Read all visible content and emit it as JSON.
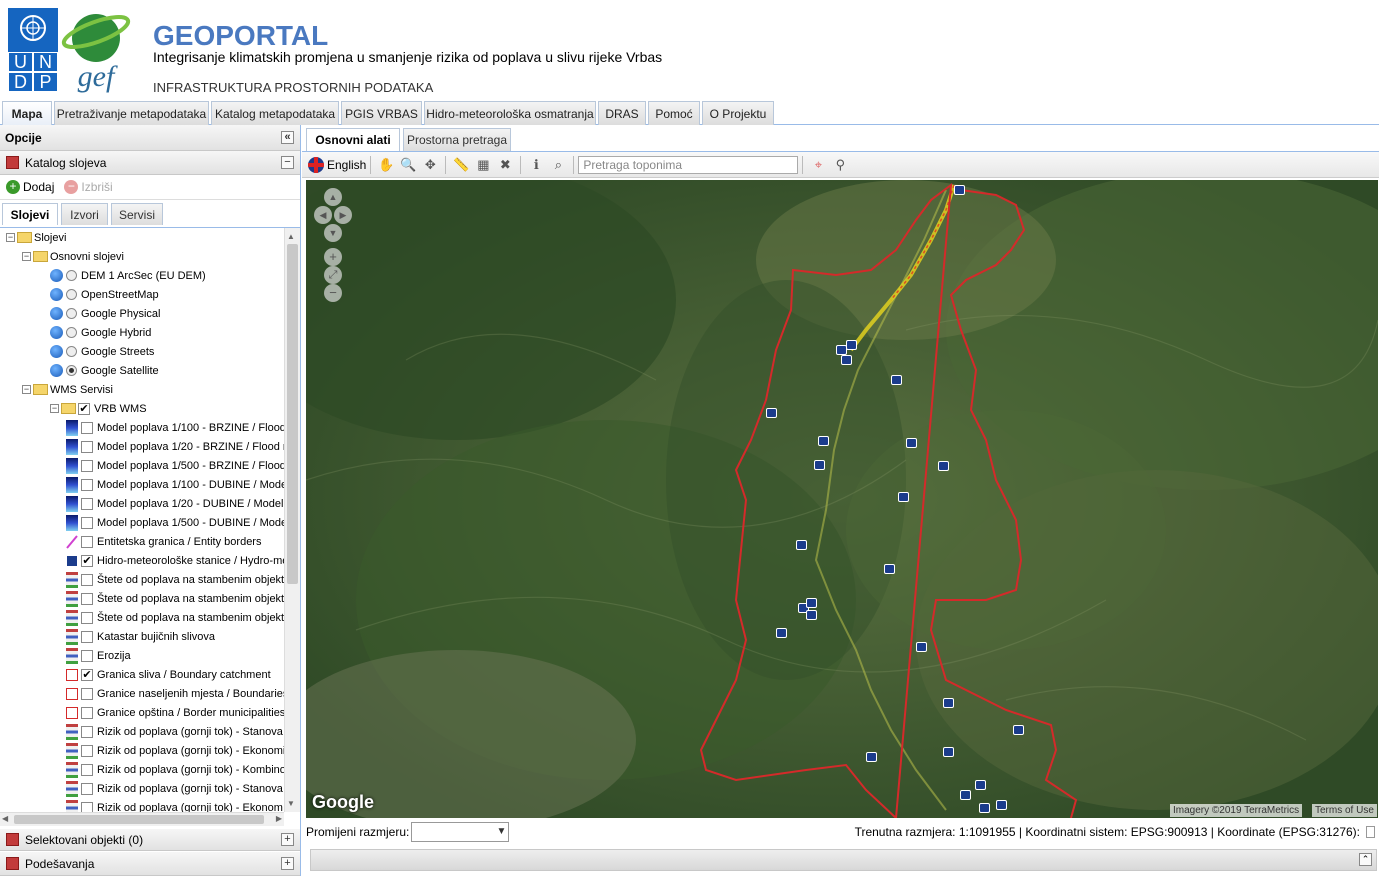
{
  "header": {
    "undp_letters": [
      "U",
      "N",
      "D",
      "P"
    ],
    "gef_logo": "gef",
    "title": "GEOPORTAL",
    "subtitle": "Integrisanje klimatskih promjena u smanjenje rizika od poplava u slivu rijeke Vrbas",
    "infra": "INFRASTRUKTURA PROSTORNIH PODATAKA"
  },
  "main_tabs": [
    {
      "label": "Mapa",
      "active": true
    },
    {
      "label": "Pretraživanje metapodataka"
    },
    {
      "label": "Katalog metapodataka"
    },
    {
      "label": "PGIS VRBAS"
    },
    {
      "label": "Hidro-meteorološka osmatranja"
    },
    {
      "label": "DRAS"
    },
    {
      "label": "Pomoć"
    },
    {
      "label": "O Projektu"
    }
  ],
  "left": {
    "title": "Opcije",
    "catalog": "Katalog slojeva",
    "add": "Dodaj",
    "remove": "Izbriši",
    "tabs": [
      "Slojevi",
      "Izvori",
      "Servisi"
    ],
    "tree": [
      {
        "level": 0,
        "type": "folder",
        "label": "Slojevi"
      },
      {
        "level": 1,
        "type": "folder",
        "label": "Osnovni slojevi"
      },
      {
        "level": 2,
        "type": "base",
        "label": "DEM 1 ArcSec (EU DEM)",
        "selected": false
      },
      {
        "level": 2,
        "type": "base",
        "label": "OpenStreetMap",
        "selected": false
      },
      {
        "level": 2,
        "type": "base",
        "label": "Google Physical",
        "selected": false
      },
      {
        "level": 2,
        "type": "base",
        "label": "Google Hybrid",
        "selected": false
      },
      {
        "level": 2,
        "type": "base",
        "label": "Google Streets",
        "selected": false
      },
      {
        "level": 2,
        "type": "base",
        "label": "Google Satellite",
        "selected": true
      },
      {
        "level": 1,
        "type": "folder",
        "label": "WMS Servisi"
      },
      {
        "level": 2,
        "type": "wmsfolder",
        "label": "VRB WMS",
        "checked": true
      },
      {
        "level": 3,
        "type": "layer",
        "legend": "ramp",
        "label": "Model poplava 1/100 - BRZINE / Flood",
        "checked": false
      },
      {
        "level": 3,
        "type": "layer",
        "legend": "ramp",
        "label": "Model poplava 1/20 - BRZINE / Flood m",
        "checked": false
      },
      {
        "level": 3,
        "type": "layer",
        "legend": "ramp",
        "label": "Model poplava 1/500 - BRZINE / Flood",
        "checked": false
      },
      {
        "level": 3,
        "type": "layer",
        "legend": "ramp",
        "label": "Model poplava 1/100 - DUBINE / Mode",
        "checked": false
      },
      {
        "level": 3,
        "type": "layer",
        "legend": "ramp",
        "label": "Model poplava 1/20 - DUBINE / Model",
        "checked": false
      },
      {
        "level": 3,
        "type": "layer",
        "legend": "ramp",
        "label": "Model poplava 1/500 - DUBINE / Mode",
        "checked": false
      },
      {
        "level": 3,
        "type": "layer",
        "legend": "line",
        "label": "Entitetska granica / Entity borders",
        "checked": false
      },
      {
        "level": 3,
        "type": "layer",
        "legend": "station",
        "label": "Hidro-meteorološke stanice / Hydro-me",
        "checked": true
      },
      {
        "level": 3,
        "type": "layer",
        "legend": "multi",
        "label": "Štete od poplava na stambenim objekt",
        "checked": false
      },
      {
        "level": 3,
        "type": "layer",
        "legend": "multi",
        "label": "Štete od poplava na stambenim objekt",
        "checked": false
      },
      {
        "level": 3,
        "type": "layer",
        "legend": "multi",
        "label": "Štete od poplava na stambenim objekt",
        "checked": false
      },
      {
        "level": 3,
        "type": "layer",
        "legend": "multi",
        "label": "Katastar bujičnih slivova",
        "checked": false
      },
      {
        "level": 3,
        "type": "layer",
        "legend": "multi",
        "label": "Erozija",
        "checked": false
      },
      {
        "level": 3,
        "type": "layer",
        "legend": "box",
        "label": "Granica sliva / Boundary catchment",
        "checked": true
      },
      {
        "level": 3,
        "type": "layer",
        "legend": "box",
        "label": "Granice naseljenih mjesta / Boundaries",
        "checked": false
      },
      {
        "level": 3,
        "type": "layer",
        "legend": "box",
        "label": "Granice opština / Border municipalities",
        "checked": false
      },
      {
        "level": 3,
        "type": "layer",
        "legend": "multi",
        "label": "Rizik od poplava (gornji tok) - Stanova",
        "checked": false
      },
      {
        "level": 3,
        "type": "layer",
        "legend": "multi",
        "label": "Rizik od poplava (gornji tok) - Ekonomi",
        "checked": false
      },
      {
        "level": 3,
        "type": "layer",
        "legend": "multi",
        "label": "Rizik od poplava (gornji tok) - Kombino",
        "checked": false
      },
      {
        "level": 3,
        "type": "layer",
        "legend": "multi",
        "label": "Rizik od poplava (gornji tok) - Stanova",
        "checked": false
      },
      {
        "level": 3,
        "type": "layer",
        "legend": "multi",
        "label": "Rizik od poplava (gornji tok) - Ekonom",
        "checked": false
      }
    ],
    "selected_objects": "Selektovani objekti (0)",
    "settings": "Podešavanja"
  },
  "right": {
    "tabs": [
      "Osnovni alati",
      "Prostorna pretraga"
    ],
    "language": "English",
    "search_placeholder": "Pretraga toponima",
    "map_google": "Google",
    "map_attrib": "Imagery ©2019 TerraMetrics",
    "map_terms": "Terms of Use",
    "scale_label": "Promijeni razmjeru:",
    "status_text": "Trenutna razmjera: 1:1091955 | Koordinatni sistem: EPSG:900913 | Koordinate (EPSG:31276):"
  },
  "colors": {
    "boundary": "#d42a2a",
    "accent": "#4a79c0",
    "station": "#1b3c8c"
  }
}
